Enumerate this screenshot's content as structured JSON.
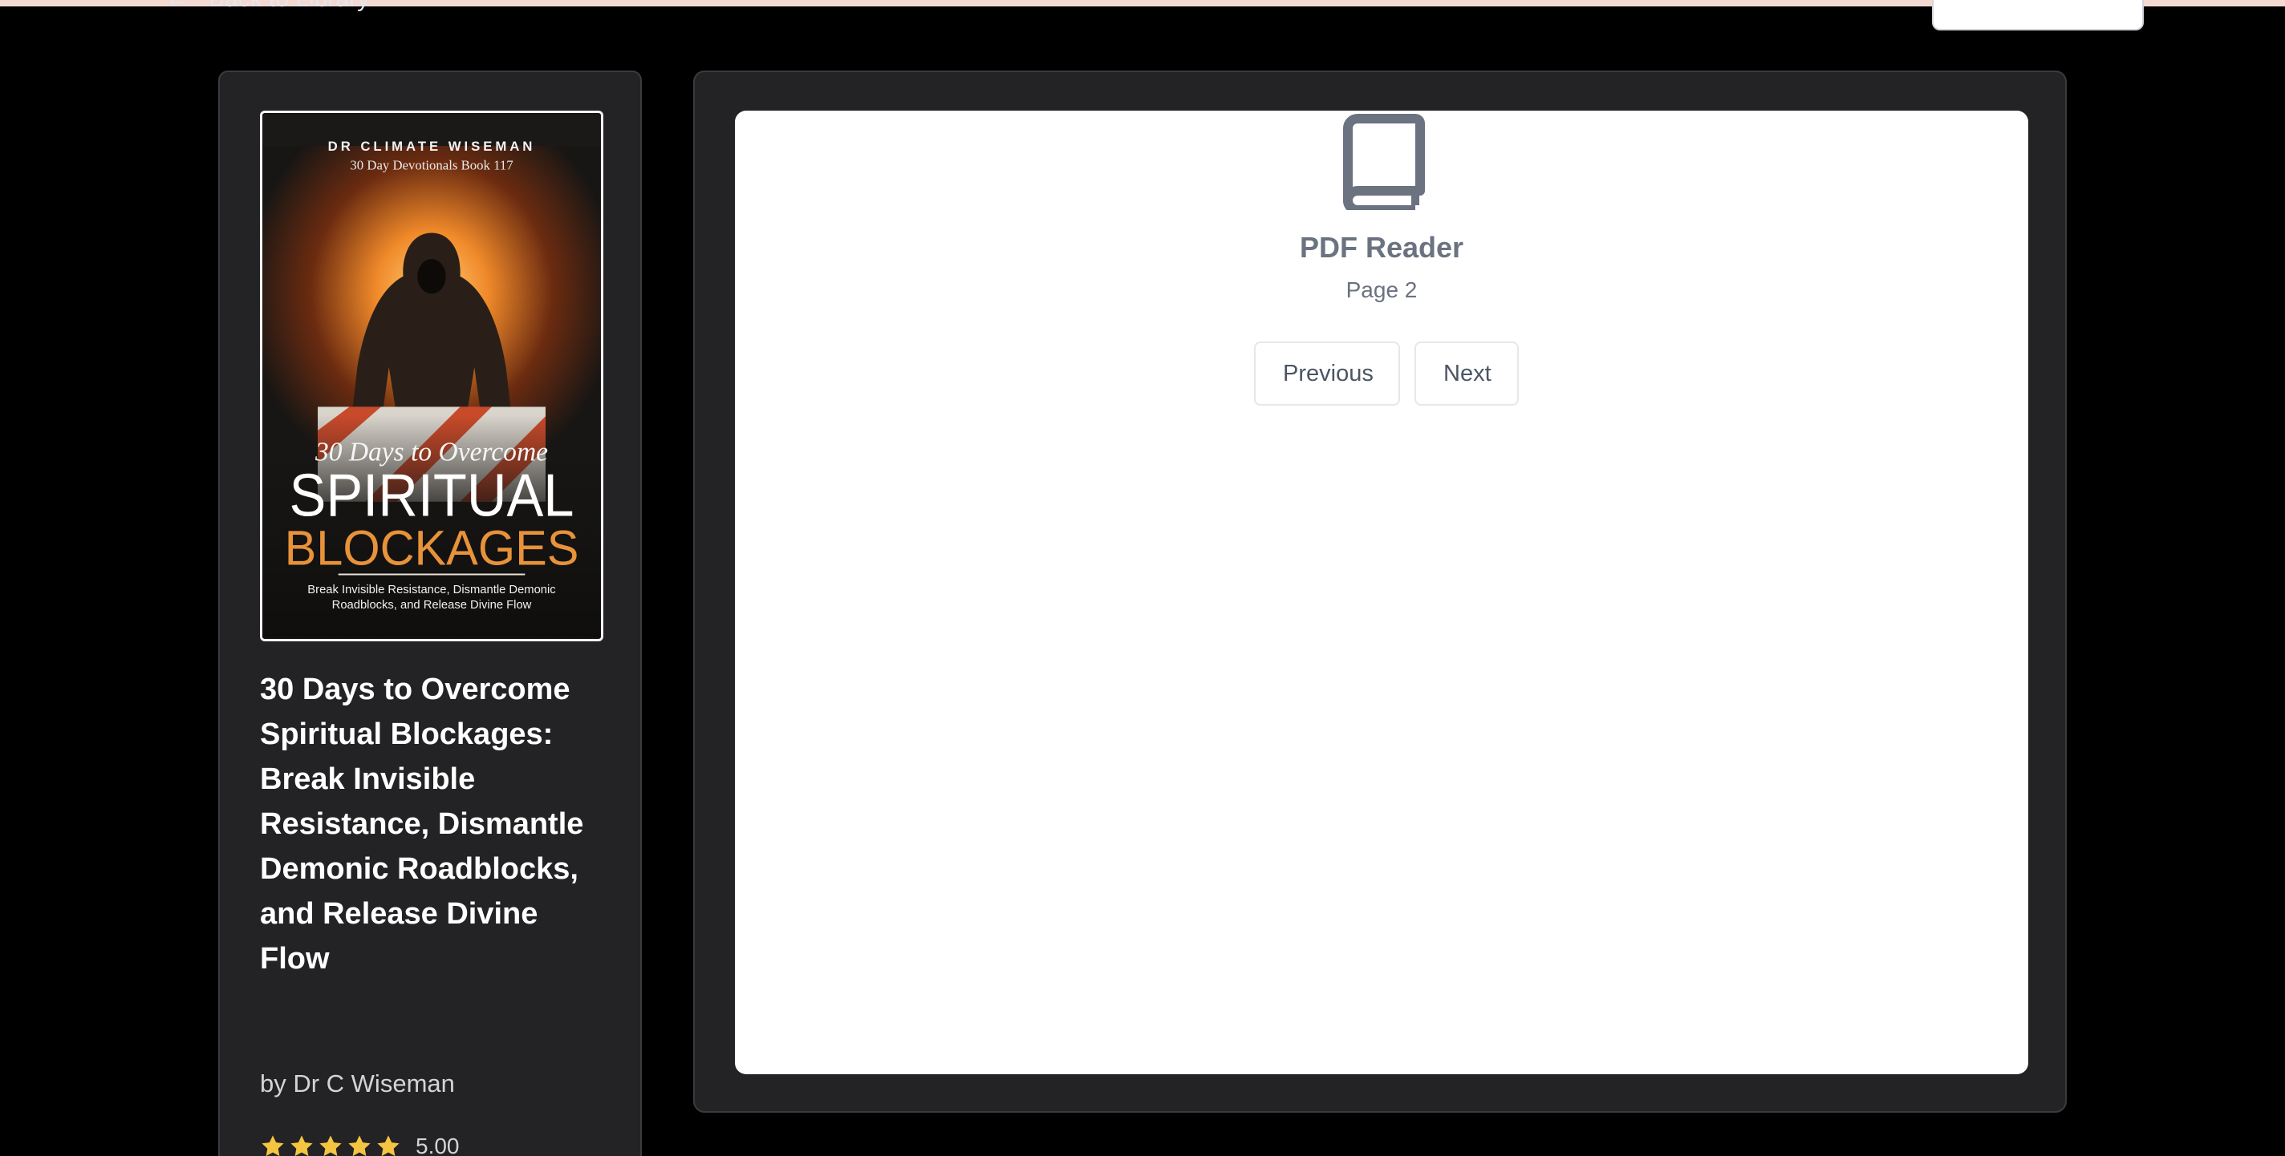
{
  "header": {
    "back_label": "Back to Library"
  },
  "book": {
    "cover": {
      "author_line": "DR CLIMATE WISEMAN",
      "series_line": "30 Day Devotionals Book 117",
      "script_title": "30 Days to Overcome",
      "title_word_1": "SPIRITUAL",
      "title_word_2": "BLOCKAGES",
      "subtitle_line_1": "Break Invisible Resistance, Dismantle Demonic",
      "subtitle_line_2": "Roadblocks, and Release Divine Flow",
      "accent_color": "#e8923a"
    },
    "title": "30 Days to Overcome Spiritual Blockages: Break Invisible Resistance, Dismantle Demonic Roadblocks, and Release Divine Flow",
    "author": "by Dr C Wiseman",
    "rating": {
      "stars": 5,
      "max_stars": 5,
      "value": "5.00",
      "star_color": "#f5c542"
    }
  },
  "reader": {
    "icon": "book-icon",
    "title": "PDF Reader",
    "page_label": "Page 2",
    "previous_label": "Previous",
    "next_label": "Next"
  }
}
